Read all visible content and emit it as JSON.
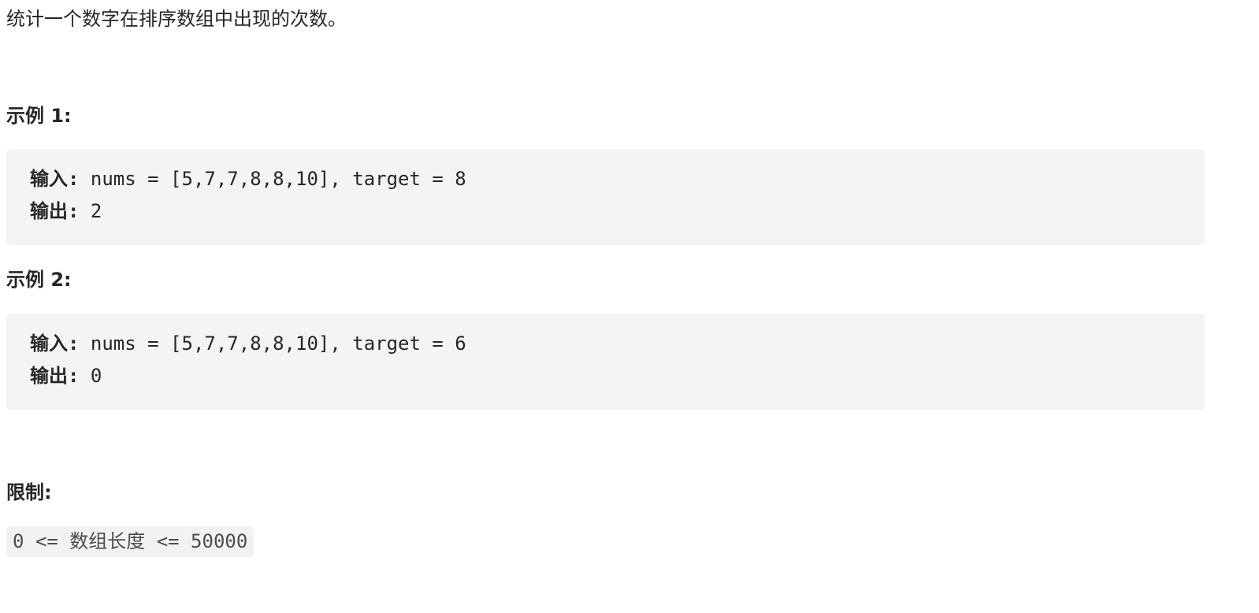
{
  "description": "统计一个数字在排序数组中出现的次数。",
  "examples": [
    {
      "heading": "示例 1:",
      "input_label": "输入:",
      "input_value": "nums = [5,7,7,8,8,10], target = 8",
      "output_label": "输出:",
      "output_value": "2"
    },
    {
      "heading": "示例 2:",
      "input_label": "输入:",
      "input_value": "nums = [5,7,7,8,8,10], target = 6",
      "output_label": "输出:",
      "output_value": "0"
    }
  ],
  "constraints": {
    "heading": "限制:",
    "items": [
      "0 <= 数组长度 <= 50000"
    ]
  }
}
